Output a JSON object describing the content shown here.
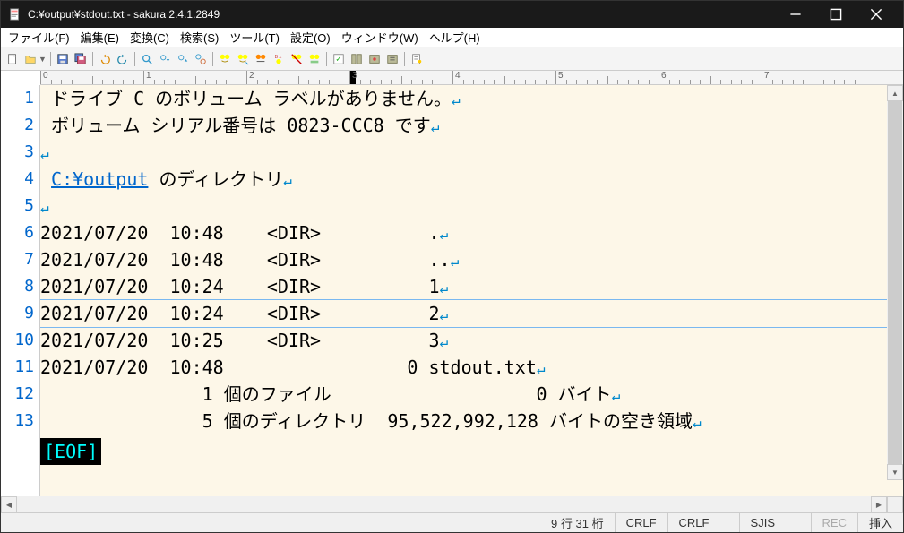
{
  "window": {
    "title": "C:¥output¥stdout.txt - sakura 2.4.1.2849"
  },
  "menu": {
    "file": "ファイル(F)",
    "edit": "編集(E)",
    "convert": "変換(C)",
    "search": "検索(S)",
    "tool": "ツール(T)",
    "setting": "設定(O)",
    "window": "ウィンドウ(W)",
    "help": "ヘルプ(H)"
  },
  "ruler": {
    "ticks": [
      "0",
      "1",
      "2",
      "3",
      "4",
      "5",
      "6",
      "7"
    ]
  },
  "lines": [
    " ドライブ C のボリューム ラベルがありません。",
    " ボリューム シリアル番号は 0823-CCC8 です",
    "",
    " {LINK} のディレクトリ",
    "",
    "2021/07/20  10:48    <DIR>          .",
    "2021/07/20  10:48    <DIR>          ..",
    "2021/07/20  10:24    <DIR>          1",
    "2021/07/20  10:24    <DIR>          2",
    "2021/07/20  10:25    <DIR>          3",
    "2021/07/20  10:48                 0 stdout.txt",
    "               1 個のファイル                   0 バイト",
    "               5 個のディレクトリ  95,522,992,128 バイトの空き領域"
  ],
  "link_text": "C:¥output",
  "eof": "[EOF]",
  "current_line_index": 8,
  "status": {
    "row_col": "9 行 31 桁",
    "newline1": "CRLF",
    "newline2": "CRLF",
    "encoding": "SJIS",
    "rec": "REC",
    "insert": "挿入"
  }
}
